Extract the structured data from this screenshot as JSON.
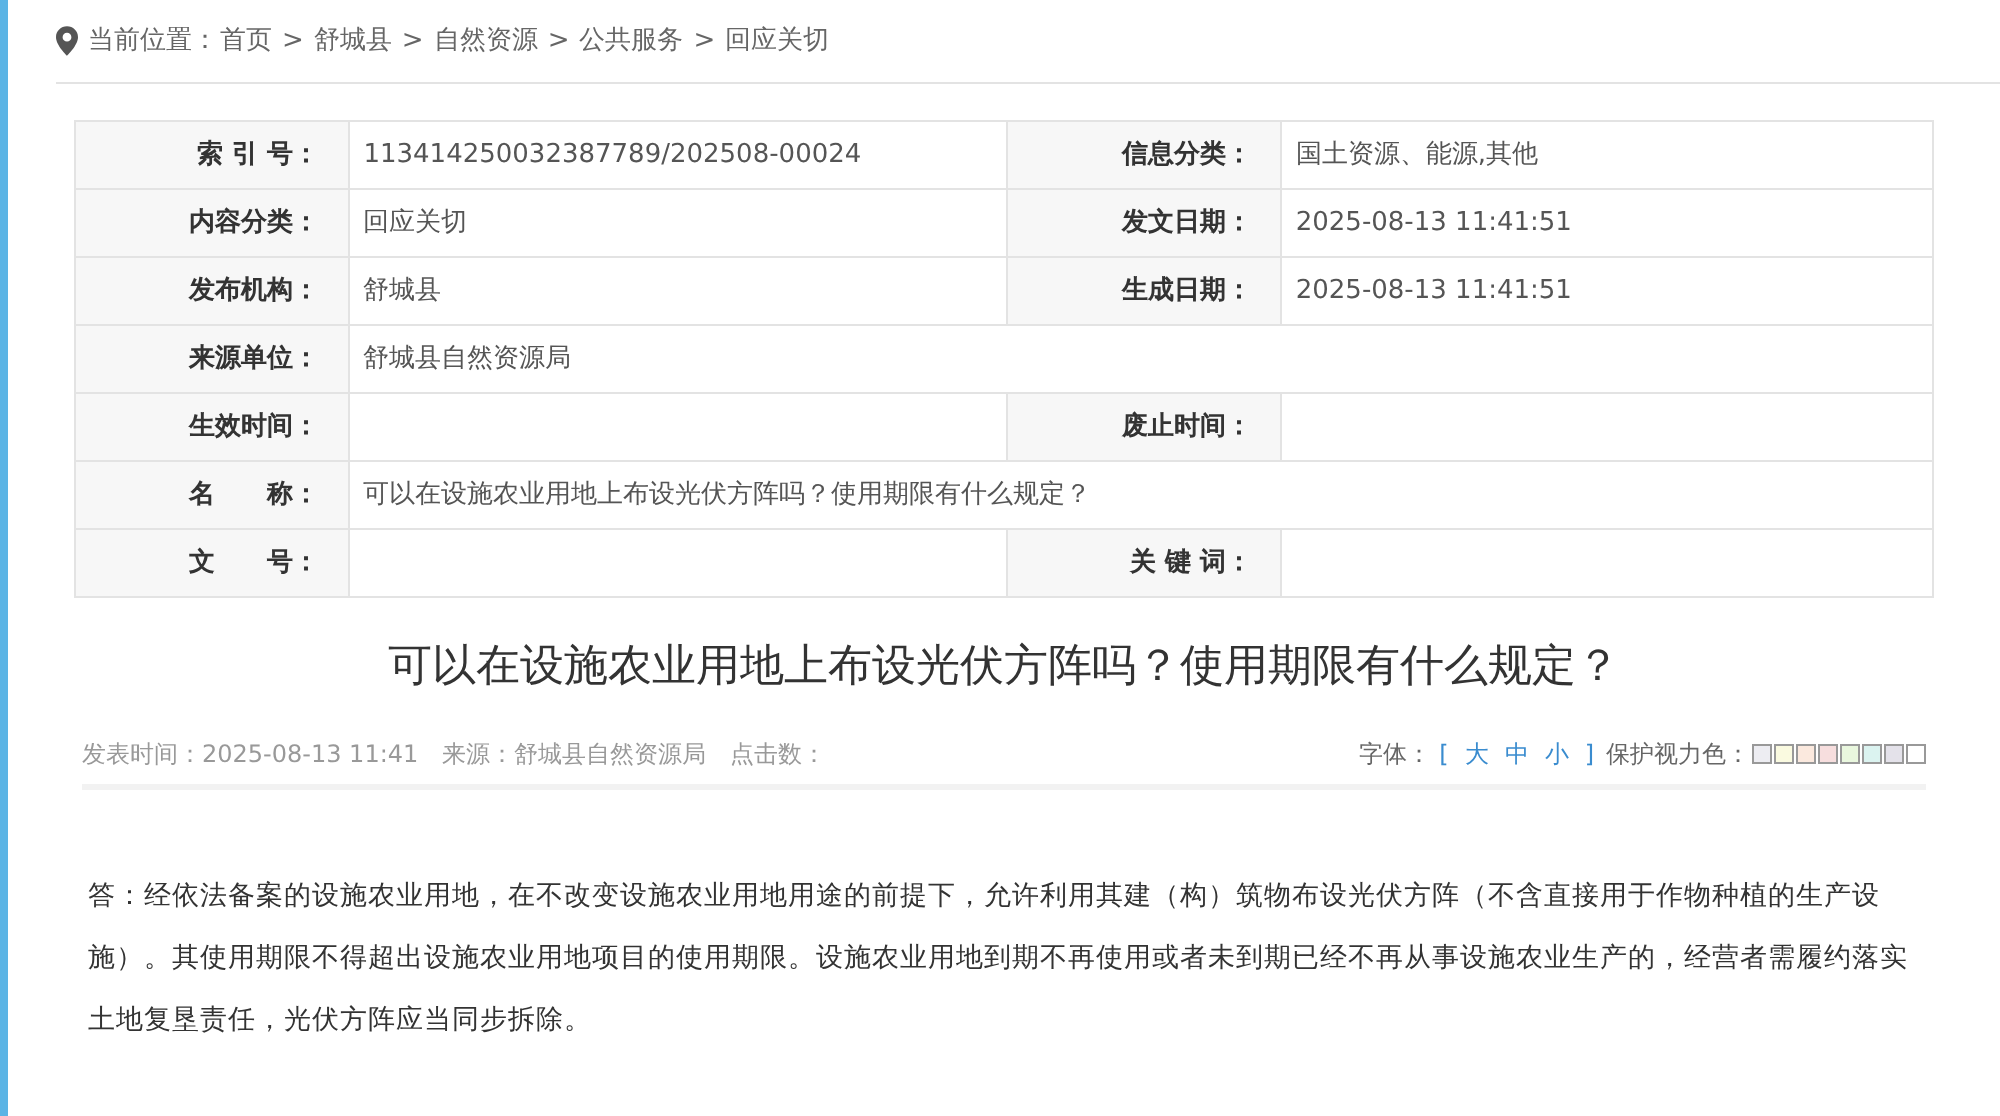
{
  "breadcrumb": {
    "label": "当前位置：",
    "items": [
      "首页",
      "舒城县",
      "自然资源",
      "公共服务",
      "回应关切"
    ],
    "separators": [
      ">",
      ">",
      ">",
      ">"
    ]
  },
  "info_table": {
    "rows": [
      {
        "cells": [
          {
            "label": "索 引 号：",
            "value": "113414250032387789/202508-00024"
          },
          {
            "label": "信息分类：",
            "value": "国土资源、能源,其他"
          }
        ]
      },
      {
        "cells": [
          {
            "label": "内容分类：",
            "value": "回应关切"
          },
          {
            "label": "发文日期：",
            "value": "2025-08-13 11:41:51"
          }
        ]
      },
      {
        "cells": [
          {
            "label": "发布机构：",
            "value": "舒城县"
          },
          {
            "label": "生成日期：",
            "value": "2025-08-13 11:41:51"
          }
        ]
      },
      {
        "cells": [
          {
            "label": "来源单位：",
            "value": "舒城县自然资源局"
          }
        ]
      },
      {
        "cells": [
          {
            "label": "生效时间："
          },
          {
            "label": "废止时间："
          }
        ]
      },
      {
        "cells": [
          {
            "label": "名　　称：",
            "value": "可以在设施农业用地上布设光伏方阵吗？使用期限有什么规定？"
          }
        ]
      },
      {
        "cells": [
          {
            "label": "文　　号："
          },
          {
            "label": "关 键 词："
          }
        ]
      }
    ]
  },
  "article": {
    "title": "可以在设施农业用地上布设光伏方阵吗？使用期限有什么规定？",
    "meta": [
      "发表时间：2025-08-13 11:41",
      "来源：舒城县自然资源局",
      "点击数："
    ],
    "font_size": {
      "label": "字体：",
      "open": "[",
      "options": [
        "大",
        "中",
        "小"
      ],
      "close": "]"
    },
    "eye_color": {
      "label": "保护视力色：",
      "swatches": [
        {
          "color": "#ededf2"
        },
        {
          "color": "#fafae0"
        },
        {
          "color": "#fbe9de"
        },
        {
          "color": "#f7dede"
        },
        {
          "color": "#e9f7de"
        },
        {
          "color": "#dbf3f0"
        },
        {
          "color": "#e4e2ea"
        },
        {
          "color": "#ffffff"
        }
      ]
    },
    "body": "答：经依法备案的设施农业用地，在不改变设施农业用地用途的前提下，允许利用其建（构）筑物布设光伏方阵（不含直接用于作物种植的生产设施）。其使用期限不得超出设施农业用地项目的使用期限。设施农业用地到期不再使用或者未到期已经不再从事设施农业生产的，经营者需履约落实土地复垦责任，光伏方阵应当同步拆除。"
  }
}
